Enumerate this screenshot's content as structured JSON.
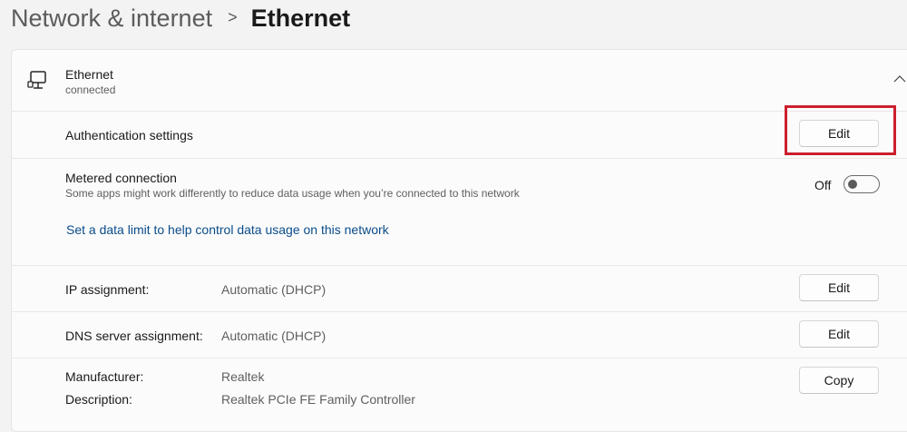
{
  "header": {
    "parent": "Network & internet",
    "separator": ">",
    "current": "Ethernet"
  },
  "adapter": {
    "icon": "ethernet-pc-icon",
    "name": "Ethernet",
    "status": "connected",
    "collapse_icon": "chevron-up-icon"
  },
  "authentication": {
    "label": "Authentication settings",
    "button": "Edit"
  },
  "metered": {
    "label": "Metered connection",
    "description": "Some apps might work differently to reduce data usage when you’re connected to this network",
    "state_label": "Off",
    "enabled": false,
    "data_limit_link": "Set a data limit to help control data usage on this network"
  },
  "ip_assignment": {
    "label": "IP assignment:",
    "value": "Automatic (DHCP)",
    "button": "Edit"
  },
  "dns_assignment": {
    "label": "DNS server assignment:",
    "value": "Automatic (DHCP)",
    "button": "Edit"
  },
  "properties": {
    "manufacturer_label": "Manufacturer:",
    "manufacturer_value": "Realtek",
    "description_label": "Description:",
    "description_value": "Realtek PCIe FE Family Controller",
    "copy_button": "Copy"
  },
  "colors": {
    "highlight_border": "#cc1f2e",
    "link": "#0a4c8a"
  }
}
